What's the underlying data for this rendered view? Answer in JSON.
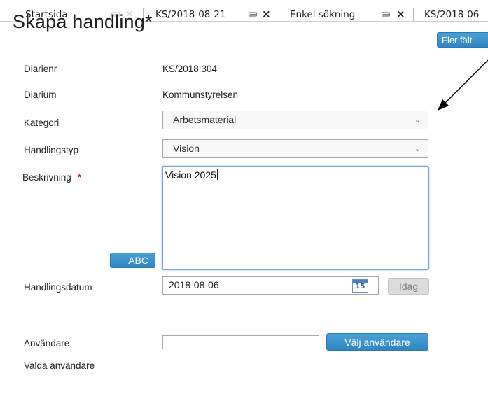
{
  "tabs": [
    {
      "label": "Startsida",
      "closable_dim": true
    },
    {
      "label": "KS/2018-08-21",
      "closable_dim": false
    },
    {
      "label": "Enkel sökning",
      "closable_dim": false
    },
    {
      "label": "KS/2018-06",
      "closable_dim": false
    }
  ],
  "tab_close_glyph": "×",
  "page": {
    "title": "Skapa handling*",
    "more_fields_button": "Fler fält"
  },
  "form": {
    "diarienr": {
      "label": "Diarienr",
      "value": "KS/2018:304"
    },
    "diarium": {
      "label": "Diarium",
      "value": "Kommunstyrelsen"
    },
    "kategori": {
      "label": "Kategori",
      "value": "Arbetsmaterial"
    },
    "handlingstyp": {
      "label": "Handlingstyp",
      "value": "Vision"
    },
    "beskrivning": {
      "label": "Beskrivning",
      "required_marker": "*",
      "value": "Vision 2025"
    },
    "spellcheck_button": "ABC",
    "handlingsdatum": {
      "label": "Handlingsdatum",
      "value": "2018-08-06",
      "calendar_day": "15"
    },
    "today_button": "Idag",
    "anvandare": {
      "label": "Användare",
      "value": ""
    },
    "choose_user_button": "Välj användare",
    "valda_anvandare": {
      "label": "Valda användare"
    }
  },
  "chevron_glyph": "⌄",
  "colors": {
    "button_blue": "#3591cc",
    "required_red": "#cc1b1b",
    "focus_border": "#6da3e0"
  }
}
